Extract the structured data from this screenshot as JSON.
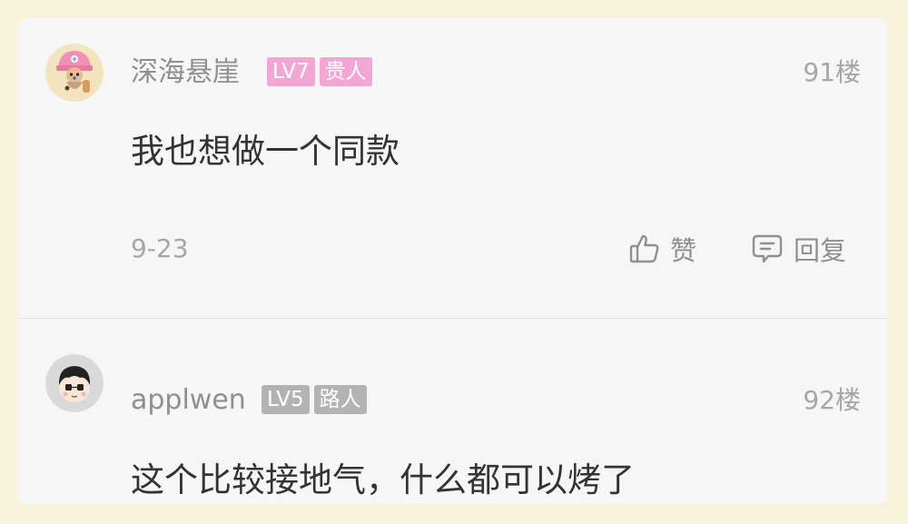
{
  "comments": [
    {
      "username": "深海悬崖",
      "level_badge": "LV7",
      "title_badge": "贵人",
      "floor": "91楼",
      "content": "我也想做一个同款",
      "date": "9-23",
      "like_label": "赞",
      "reply_label": "回复",
      "badge_color": "#f2a6d3"
    },
    {
      "username": "applwen",
      "level_badge": "LV5",
      "title_badge": "路人",
      "floor": "92楼",
      "content": "这个比较接地气，什么都可以烤了",
      "badge_color": "#b3b3b6"
    }
  ],
  "icons": {
    "like": "thumbs-up-icon",
    "reply": "chat-bubble-icon"
  },
  "colors": {
    "background": "#f7f2da",
    "card": "#f6f6f7",
    "text_primary": "#333333",
    "text_secondary": "#8f8f93"
  }
}
